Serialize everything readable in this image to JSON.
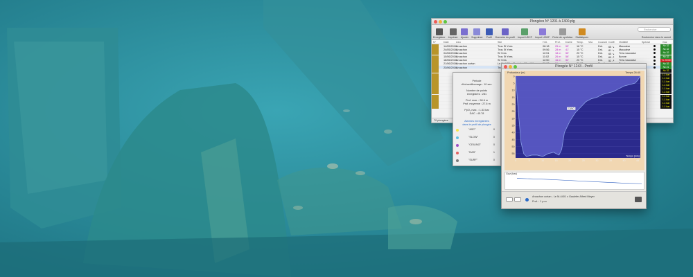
{
  "window": {
    "title": "Plongées N° 1201 à 1300.plg",
    "toolbar": [
      {
        "label": "Enregistrer",
        "icon": "save-icon",
        "color": "#555555"
      },
      {
        "label": "Imprimer",
        "icon": "printer-icon",
        "color": "#666666"
      },
      {
        "label": "Ajouter",
        "icon": "add-icon",
        "color": "#7a6fd0"
      },
      {
        "label": "Supprimer",
        "icon": "delete-icon",
        "color": "#8a8ad8"
      },
      {
        "label": "Profil",
        "icon": "profile-icon",
        "color": "#3b5bb5"
      },
      {
        "label": "Données du profil",
        "icon": "profile-data-icon",
        "color": "#6b63c7"
      },
      {
        "label": "Import UDCF",
        "icon": "import-icon",
        "color": "#5aa06a"
      },
      {
        "label": "Import UDDF",
        "icon": "import-uddf-icon",
        "color": "#8b7ad8"
      },
      {
        "label": "Fiche de synthèse",
        "icon": "sheet-icon",
        "color": "#9a9a9a"
      },
      {
        "label": "Statistiques",
        "icon": "stats-icon",
        "color": "#d08a20"
      }
    ],
    "search_placeholder": "Rechercher",
    "search_label": "Rechercher dans le carnet",
    "columns": [
      "N°",
      "Date",
      "Lieu",
      "Site",
      "H.D.",
      "Prof.",
      "Durée",
      "Temp.",
      "Visi.",
      "Courant",
      "Coeff.",
      "Visibilité",
      "Spécial",
      "Gaz"
    ],
    "rows": [
      {
        "date": "14/05/2016",
        "lieu": "Arcachon",
        "site": "Trou St Yves",
        "hd": "08:18",
        "prof": "25 m",
        "duree": "55'",
        "temp": "16 °C",
        "visi": "Drô.",
        "coef": "65 ↘",
        "vis": "Mauvaise",
        "gaz": "Nx 32"
      },
      {
        "date": "24/05/2016",
        "lieu": "Arcachon",
        "site": "Trou St Yves",
        "hd": "09:56",
        "prof": "28 m",
        "duree": "41'",
        "temp": "15 °C",
        "visi": "Drô.",
        "coef": "81 ↘",
        "vis": "Mauvaise",
        "gaz": "Nx 32"
      },
      {
        "date": "04/06/2016",
        "lieu": "Arcachon",
        "site": "St Yves",
        "hd": "12:51",
        "prof": "18 m",
        "duree": "55'",
        "temp": "20 °C",
        "visi": "Drô.",
        "coef": "65 ↘",
        "vis": "Très mauvaise",
        "gaz": "Nx 32"
      },
      {
        "date": "10/06/2016",
        "lieu": "Arcachon",
        "site": "Trou St Yves",
        "hd": "11:02",
        "prof": "26 m",
        "duree": "56'",
        "temp": "15 °C",
        "visi": "Drô.",
        "coef": "60 ↗",
        "vis": "Bonne",
        "gaz": "Nx 32"
      },
      {
        "date": "18/06/2016",
        "lieu": "Arcachon",
        "site": "St Yves",
        "hd": "12:50",
        "prof": "16 m",
        "duree": "52'",
        "temp": "20 °C",
        "visi": "Drô.",
        "coef": "52 ↗",
        "vis": "Très mauvaise",
        "gaz": "Tx 20/30"
      },
      {
        "date": "21/06/2016",
        "lieu": "Arcachon océan",
        "site": "Le M-4401 x Gaulefer Alfred Meyer",
        "hd": "09:08",
        "prof": "59 m",
        "duree": "44'",
        "temp": "20 °C",
        "visi": "Run-time",
        "coef": "PI ↗",
        "vis": "Très bonne",
        "gaz": "Nx 32"
      },
      {
        "date": "23/06/2016",
        "lieu": "Arcachon",
        "site": "Trou St Yves",
        "hd": "",
        "prof": "",
        "duree": "",
        "temp": "",
        "visi": "",
        "coef": "",
        "vis": "",
        "gaz": "Nx 21"
      }
    ],
    "hidden_rows_gaz": [
      "Nx 32",
      "1.1 bar",
      "1.1 bar",
      "1.1 bar",
      "1.1 bar",
      "1.1 bar",
      "1.1 bar",
      "1.1 bar",
      "1.1 bar",
      "1.1 bar",
      "1.1 bar"
    ],
    "footer": "70 plongées"
  },
  "side_panel": {
    "period": "Période\nd'échantillonnage : 10 sec.",
    "points": "Nombre de points\nenregistrés : 281",
    "prof": "Prof. max. : 58.6 m\nProf. moyenne : 27.6 m",
    "ppo2": "PpO₂ max. : 1.53 bar\nDAC : 45.78",
    "alarms_title": "Alarmes enregistrées\ndans le profil de plongée",
    "alarms": [
      {
        "label": "\"ASC\"",
        "count": "0",
        "color": "#f2e64a"
      },
      {
        "label": "\"SLOW\"",
        "count": "0",
        "color": "#5fc0e0"
      },
      {
        "label": "\"CEILING\"",
        "count": "0",
        "color": "#9b4fc4"
      },
      {
        "label": "\"DAS\"",
        "count": "1",
        "color": "#e06060"
      },
      {
        "label": "\"SURF\"",
        "count": "0",
        "color": "#7a7a7a"
      }
    ]
  },
  "profile_window": {
    "title": "Plongée N° 1243 - Profil",
    "y_label": "Profondeur (m)",
    "time_label": "Temps (min)",
    "marker": "CANO",
    "top_right": "Temps 26:40",
    "gas_label": "Gaz (bar)",
    "dive_label": "Arcachon océan - Le M-4401 x Gaulefer Alfred Meyer",
    "dive_sub": "Prof. : 1 p.m",
    "gas_axis": [
      "250",
      "200",
      "150",
      "100",
      "50",
      "0"
    ]
  },
  "chart_data": {
    "type": "area",
    "xlabel": "Temps (min)",
    "ylabel": "Profondeur (m)",
    "x_ticks": [
      0,
      5,
      10,
      15,
      20,
      25,
      30,
      35,
      40,
      45
    ],
    "y_ticks": [
      0,
      5,
      10,
      15,
      20,
      25,
      30,
      35,
      40,
      45,
      50,
      55
    ],
    "xlim": [
      0,
      46
    ],
    "ylim": [
      0,
      58
    ],
    "series": [
      {
        "x": [
          0,
          1,
          2,
          3,
          4,
          6,
          8,
          10,
          12,
          14,
          16,
          17,
          18,
          20,
          22,
          24,
          26,
          28,
          30,
          32,
          34,
          36,
          38,
          40,
          42,
          44,
          45,
          46
        ],
        "y": [
          0,
          25,
          47,
          55,
          57,
          56,
          56,
          57,
          55,
          54,
          56,
          52,
          40,
          32,
          26,
          22,
          18,
          16,
          15,
          13,
          12,
          11,
          9,
          7,
          6,
          5,
          3,
          0
        ]
      }
    ],
    "gas": {
      "x": [
        0,
        10,
        20,
        30,
        40,
        46
      ],
      "y": [
        210,
        190,
        160,
        130,
        100,
        90
      ]
    }
  }
}
